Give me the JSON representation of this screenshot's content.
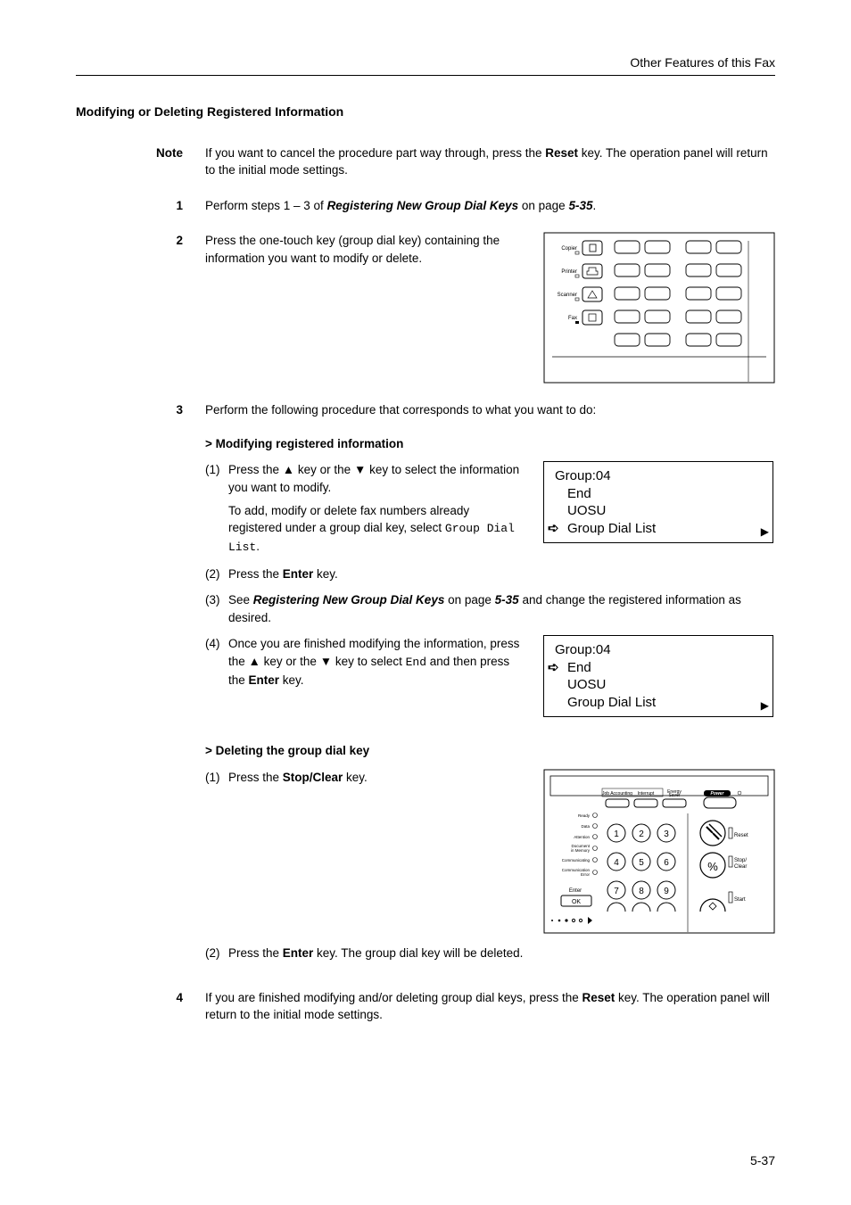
{
  "header": {
    "chapter_title": "Other Features of this Fax"
  },
  "section": {
    "title": "Modifying or Deleting Registered Information"
  },
  "note": {
    "label": "Note",
    "text_before": "If you want to cancel the procedure part way through, press the ",
    "reset_key": "Reset",
    "text_after": " key. The operation panel will return to the initial mode settings."
  },
  "steps": {
    "s1": {
      "num": "1",
      "text_before": "Perform steps 1 – 3 of ",
      "ref": "Registering New Group Dial Keys",
      "on_page": " on page ",
      "page_ref": "5-35",
      "period": "."
    },
    "s2": {
      "num": "2",
      "text": "Press the one-touch key (group dial key) containing the information you want to modify or delete."
    },
    "s3": {
      "num": "3",
      "intro": "Perform the following procedure that corresponds to what you want to do:",
      "modify": {
        "heading": "> Modifying registered information",
        "ss1": {
          "label": "(1)",
          "text_a": "Press the ",
          "text_b": " key or the ",
          "text_c": " key to select the information you want to modify.",
          "text_d": "To add, modify or delete fax numbers already registered under a group dial key, select ",
          "code": "Group Dial List",
          "period": "."
        },
        "ss2": {
          "label": "(2)",
          "text_a": "Press the ",
          "enter": "Enter",
          "text_b": " key."
        },
        "ss3": {
          "label": "(3)",
          "text_a": "See ",
          "ref": "Registering New Group Dial Keys",
          "on_page": " on page ",
          "page_ref": "5-35",
          "text_b": " and change the registered information as desired."
        },
        "ss4": {
          "label": "(4)",
          "text_a": "Once you are finished modifying the information, press the ",
          "text_b": " key or the ",
          "text_c": " key to select ",
          "code": "End",
          "text_d": " and then press the ",
          "enter": "Enter",
          "text_e": " key."
        }
      },
      "delete": {
        "heading": "> Deleting the group dial key",
        "ss1": {
          "label": "(1)",
          "text_a": "Press the ",
          "stop_clear": "Stop/Clear",
          "text_b": " key."
        },
        "ss2": {
          "label": "(2)",
          "text_a": "Press the ",
          "enter": "Enter",
          "text_b": " key. The group dial key will be deleted."
        }
      }
    },
    "s4": {
      "num": "4",
      "text_a": "If you are finished modifying and/or deleting group dial keys, press the ",
      "reset": "Reset",
      "text_b": " key. The operation panel will return to the initial mode settings."
    }
  },
  "lcd1": {
    "l1": "Group:04",
    "l2": "End",
    "l3": "UOSU",
    "l4": "Group Dial List"
  },
  "lcd2": {
    "l1": "Group:04",
    "l2": "End",
    "l3": "UOSU",
    "l4": "Group Dial List"
  },
  "panel1": {
    "labels": [
      "Copier",
      "Printer",
      "Scanner",
      "Fax"
    ]
  },
  "panel2": {
    "top_labels": [
      "Job Accounting",
      "Interrupt",
      "Energy Saver",
      "Power"
    ],
    "side_labels": [
      "Ready",
      "Data",
      "Attention",
      "Document in Memory",
      "Communicating",
      "Communication Error"
    ],
    "enter_label": "Enter",
    "right_labels": [
      "Reset",
      "Stop/Clear",
      "Start"
    ]
  },
  "footer": {
    "page_num": "5-37"
  }
}
